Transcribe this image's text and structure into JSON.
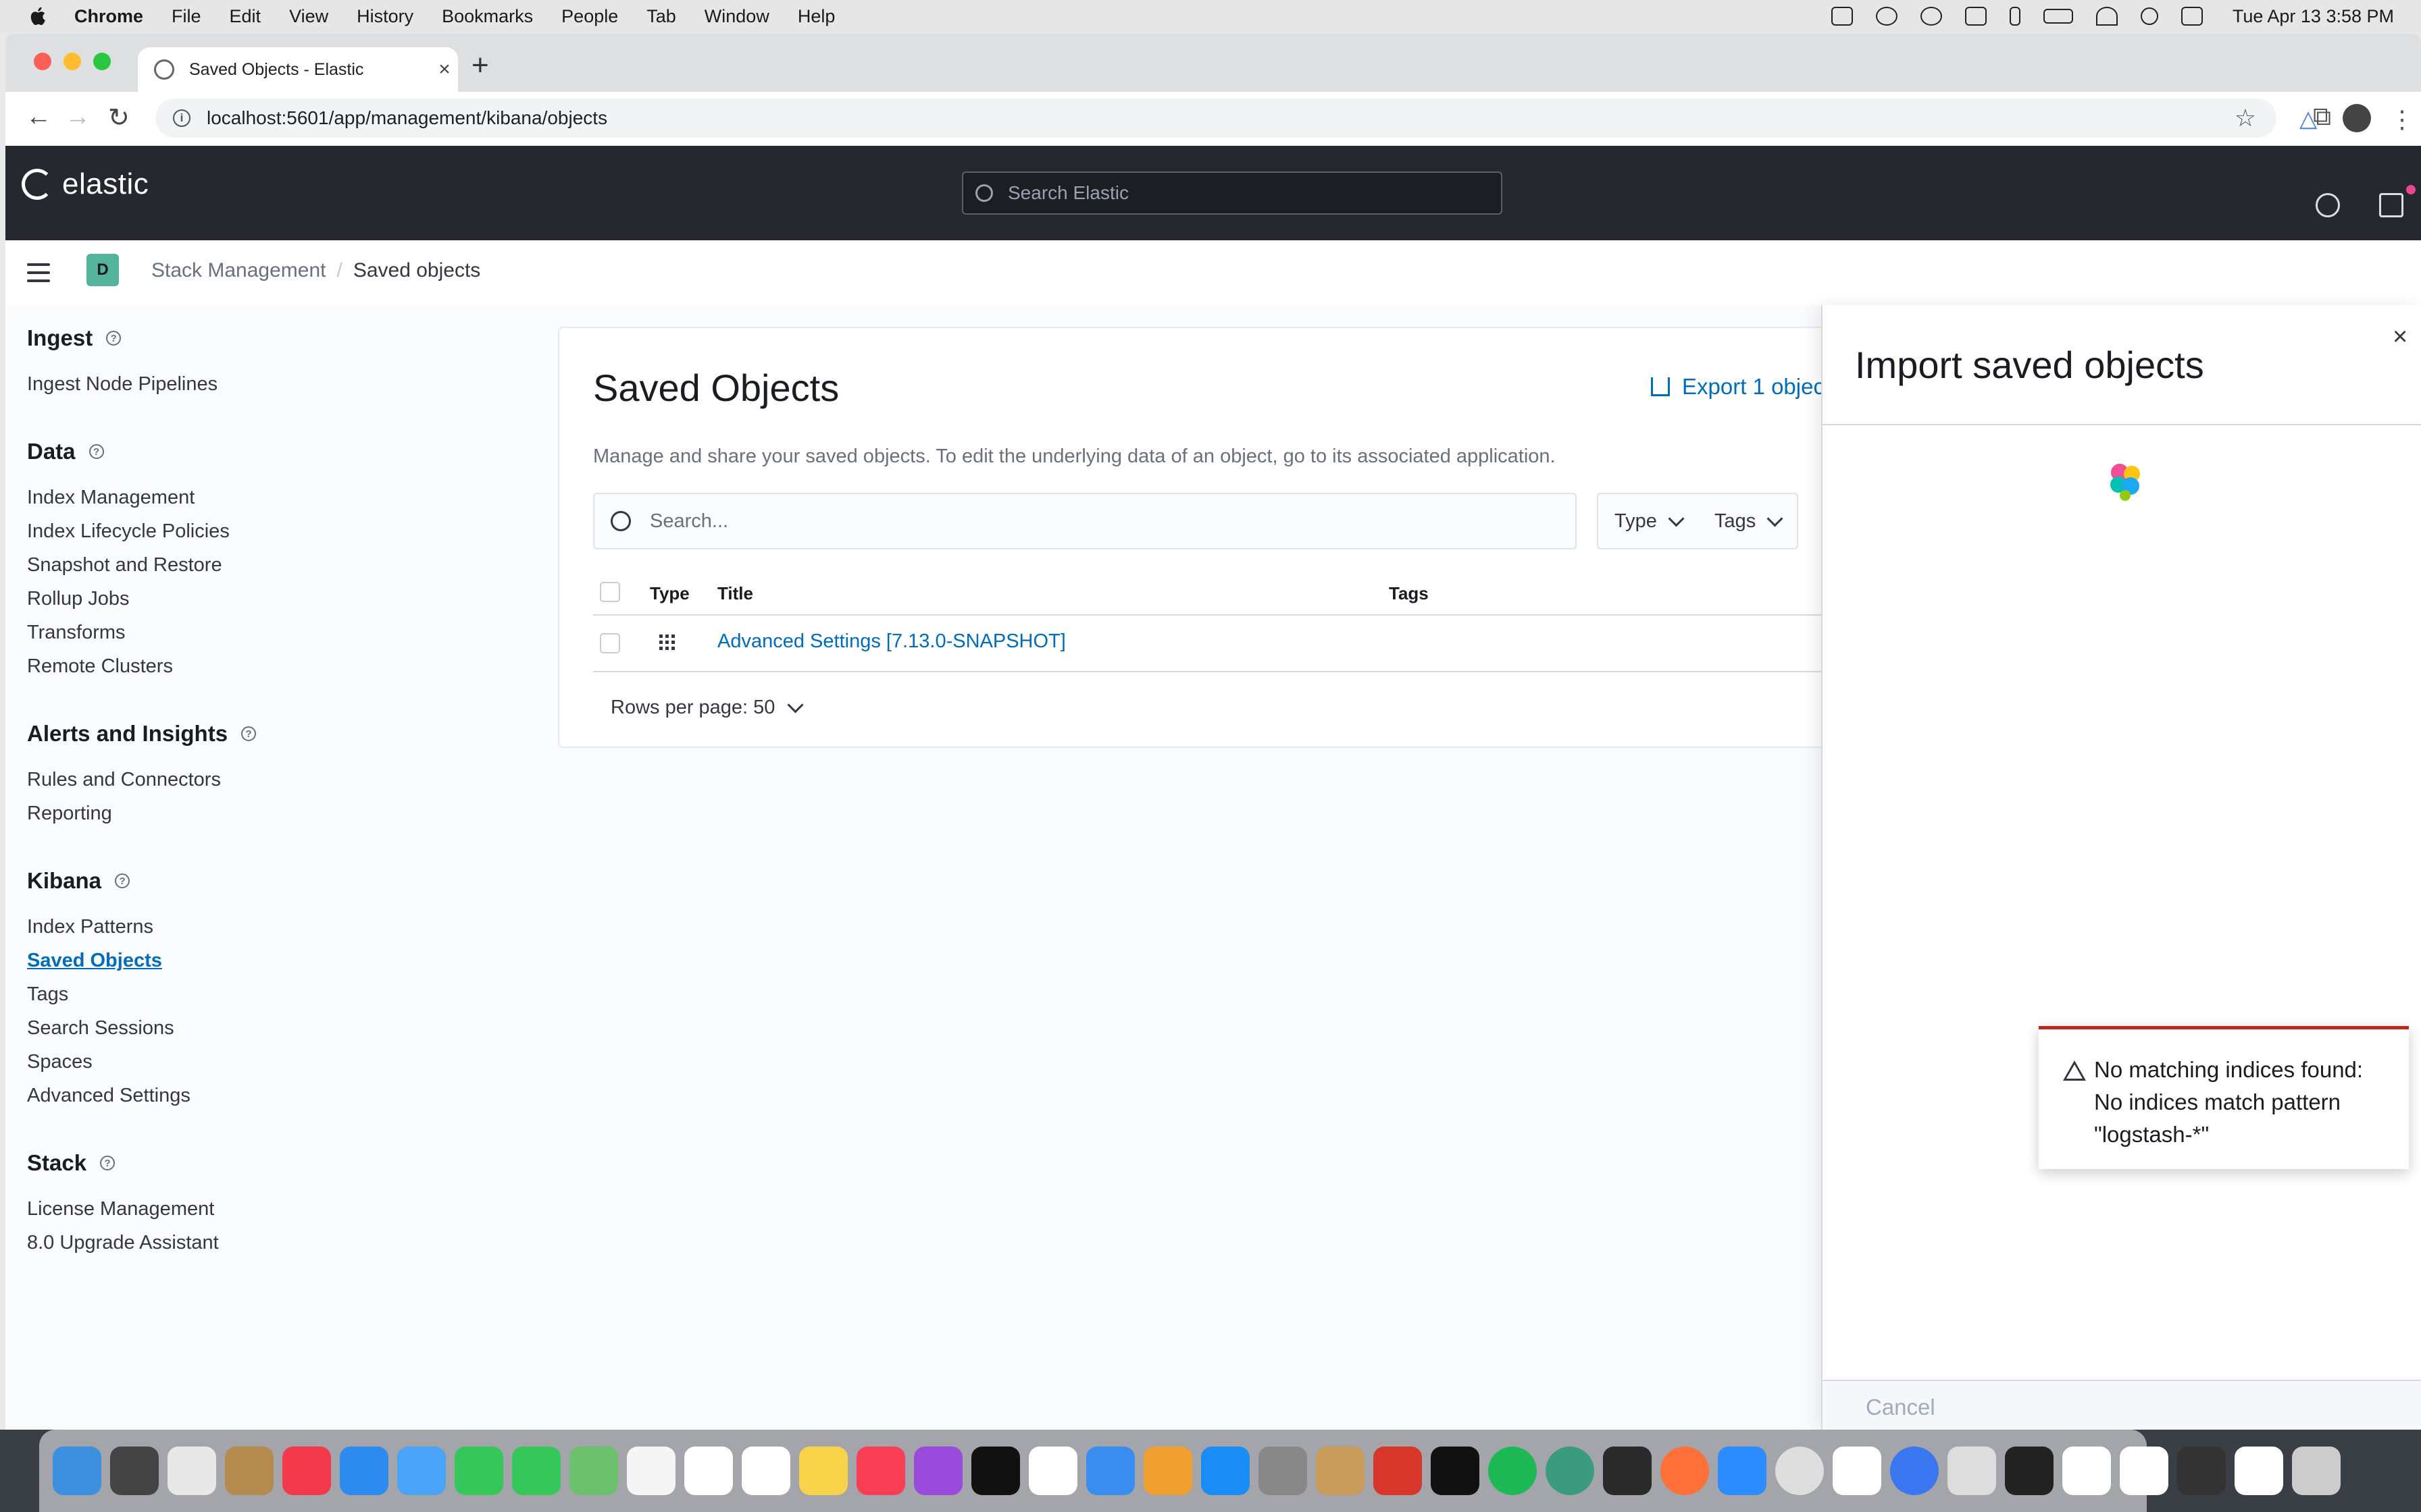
{
  "menubar": {
    "app": "Chrome",
    "items": [
      "File",
      "Edit",
      "View",
      "History",
      "Bookmarks",
      "People",
      "Tab",
      "Window",
      "Help"
    ],
    "clock": "Tue Apr 13  3:58 PM"
  },
  "browser": {
    "tab_title": "Saved Objects - Elastic",
    "url": "localhost:5601/app/management/kibana/objects"
  },
  "elastic_header": {
    "logo_text": "elastic",
    "search_placeholder": "Search Elastic"
  },
  "breadcrumb": {
    "space_initial": "D",
    "items": [
      "Stack Management",
      "Saved objects"
    ]
  },
  "sidenav": {
    "groups": [
      {
        "title": "Ingest",
        "items": [
          "Ingest Node Pipelines"
        ]
      },
      {
        "title": "Data",
        "items": [
          "Index Management",
          "Index Lifecycle Policies",
          "Snapshot and Restore",
          "Rollup Jobs",
          "Transforms",
          "Remote Clusters"
        ]
      },
      {
        "title": "Alerts and Insights",
        "items": [
          "Rules and Connectors",
          "Reporting"
        ]
      },
      {
        "title": "Kibana",
        "items": [
          "Index Patterns",
          "Saved Objects",
          "Tags",
          "Search Sessions",
          "Spaces",
          "Advanced Settings"
        ]
      },
      {
        "title": "Stack",
        "items": [
          "License Management",
          "8.0 Upgrade Assistant"
        ]
      }
    ],
    "active_item": "Saved Objects"
  },
  "main": {
    "title": "Saved Objects",
    "export_label": "Export 1 objec",
    "description": "Manage and share your saved objects. To edit the underlying data of an object, go to its associated application.",
    "search_placeholder": "Search...",
    "filters": [
      "Type",
      "Tags"
    ],
    "columns": [
      "Type",
      "Title",
      "Tags"
    ],
    "rows": [
      {
        "title": "Advanced Settings [7.13.0-SNAPSHOT]"
      }
    ],
    "rows_per_page": "Rows per page: 50"
  },
  "flyout": {
    "title": "Import saved objects",
    "cancel_label": "Cancel"
  },
  "toast": {
    "text": "No matching indices found: No indices match pattern \"logstash-*\""
  },
  "colors": {
    "link": "#006bb8",
    "header_bg": "#25282f",
    "toast_danger": "#bd271e",
    "space_avatar": "#54b399"
  }
}
